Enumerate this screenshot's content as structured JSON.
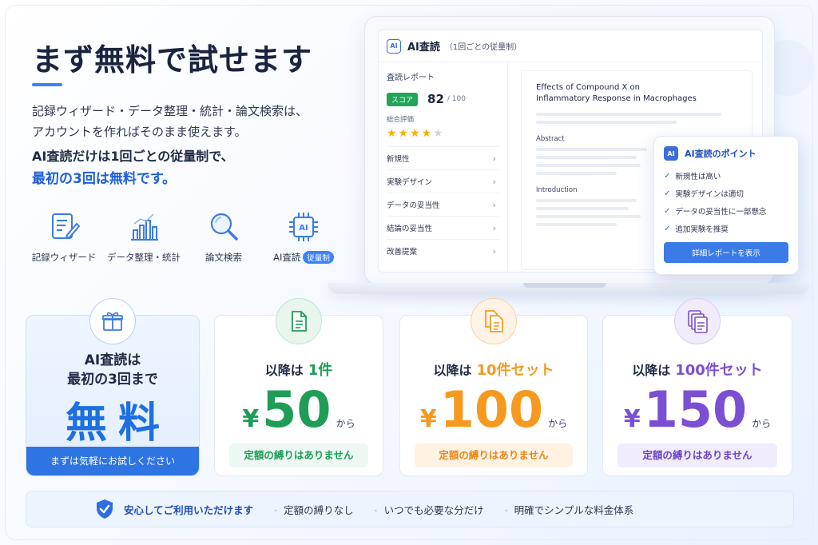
{
  "hero": {
    "title": "まず無料で試せます",
    "desc_line1": "記録ウィザード・データ整理・統計・論文検索は、",
    "desc_line2": "アカウントを作ればそのまま使えます。",
    "ai_line1": "AI査読だけは1回ごとの従量制で、",
    "ai_line2": "最初の3回は無料です。"
  },
  "features": [
    {
      "label": "記録ウィザード",
      "icon": "record-wizard-icon"
    },
    {
      "label": "データ整理・統計",
      "icon": "bar-chart-icon"
    },
    {
      "label": "論文検索",
      "icon": "search-icon"
    },
    {
      "label": "AI査読",
      "icon": "ai-chip-icon",
      "badge": "従量制"
    }
  ],
  "app": {
    "title": "AI査読",
    "subtitle": "（1回ごとの従量制）",
    "report_title": "査読レポート",
    "score_label": "スコア",
    "score": "82",
    "score_max": "/ 100",
    "overall_label": "総合評価",
    "rating": 4,
    "rating_max": 5,
    "stars_on": "★★★★",
    "stars_off": "★",
    "report_items": [
      "新規性",
      "実験デザイン",
      "データの妥当性",
      "結論の妥当性",
      "改善提案"
    ],
    "paper_title_1": "Effects of Compound X on",
    "paper_title_2": "Inflammatory Response in Macrophages",
    "abstract": "Abstract",
    "introduction": "Introduction"
  },
  "points": {
    "chip": "AI",
    "title": "AI査読のポイント",
    "items": [
      "新規性は高い",
      "実験デザインは適切",
      "データの妥当性に一部懸念",
      "追加実験を推奨"
    ],
    "button": "詳細レポートを表示"
  },
  "free_card": {
    "line1": "AI査読は",
    "line2": "最初の3回まで",
    "big": "無料",
    "bar": "まずは気軽にお試しください"
  },
  "plans": [
    {
      "prefix": "以降は",
      "unit": "1件",
      "yen": "¥",
      "price": "50",
      "suffix": "から",
      "note": "定額の縛りはありません",
      "color": "#1f9d57"
    },
    {
      "prefix": "以降は",
      "unit": "10件セット",
      "yen": "¥",
      "price": "100",
      "suffix": "から",
      "note": "定額の縛りはありません",
      "color": "#f59a1f"
    },
    {
      "prefix": "以降は",
      "unit": "100件セット",
      "yen": "¥",
      "price": "150",
      "suffix": "から",
      "note": "定額の縛りはありません",
      "color": "#7b4fd4"
    }
  ],
  "footer": {
    "main": "安心してご利用いただけます",
    "items": [
      "定額の縛りなし",
      "いつでも必要な分だけ",
      "明確でシンプルな料金体系"
    ]
  }
}
